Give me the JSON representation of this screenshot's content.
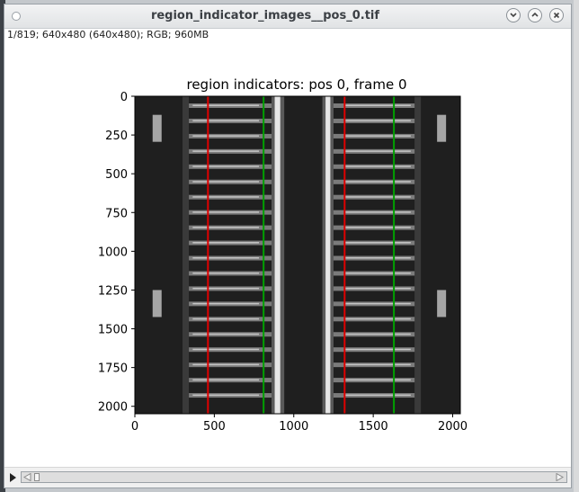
{
  "window": {
    "title": "region_indicator_images__pos_0.tif",
    "info": "1/819; 640x480   (640x480); RGB; 960MB"
  },
  "icons": {
    "window_menu": "circle-dot-icon",
    "minimize": "chevron-down-icon",
    "maximize": "chevron-up-icon",
    "close": "close-icon",
    "play": "play-icon",
    "scroll_left": "triangle-left-icon",
    "scroll_right": "triangle-right-icon"
  },
  "slider": {
    "frame": 1,
    "total": 819
  },
  "chart_data": {
    "type": "image",
    "title": "region indicators: pos 0, frame 0",
    "xlabel": "",
    "ylabel": "",
    "xlim": [
      0,
      2048
    ],
    "ylim": [
      2048,
      0
    ],
    "xticks": [
      0,
      500,
      1000,
      1500,
      2000
    ],
    "yticks": [
      0,
      250,
      500,
      750,
      1000,
      1250,
      1500,
      1750,
      2000
    ],
    "vertical_lines": [
      {
        "x": 460,
        "color": "#e00000"
      },
      {
        "x": 810,
        "color": "#00a000"
      },
      {
        "x": 1320,
        "color": "#e00000"
      },
      {
        "x": 1630,
        "color": "#00a000"
      }
    ],
    "grid": false,
    "colors": {
      "background": "#1f1f1f",
      "channel": "#e6e6e6",
      "trap": "#8c8c8c"
    }
  }
}
